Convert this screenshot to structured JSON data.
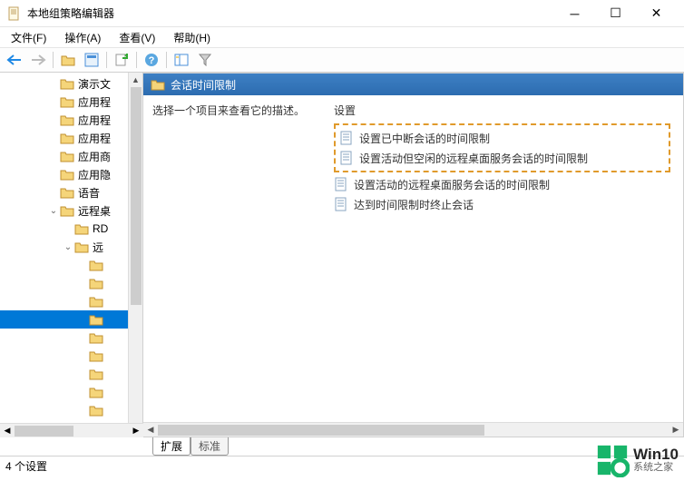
{
  "window": {
    "title": "本地组策略编辑器"
  },
  "menu": {
    "file": "文件(F)",
    "action": "操作(A)",
    "view": "查看(V)",
    "help": "帮助(H)"
  },
  "tree": {
    "items": [
      {
        "label": "演示文",
        "depth": 3,
        "expander": ""
      },
      {
        "label": "应用程",
        "depth": 3,
        "expander": ""
      },
      {
        "label": "应用程",
        "depth": 3,
        "expander": ""
      },
      {
        "label": "应用程",
        "depth": 3,
        "expander": ""
      },
      {
        "label": "应用商",
        "depth": 3,
        "expander": ""
      },
      {
        "label": "应用隐",
        "depth": 3,
        "expander": ""
      },
      {
        "label": "语音",
        "depth": 3,
        "expander": ""
      },
      {
        "label": "远程桌",
        "depth": 3,
        "expander": "v"
      },
      {
        "label": "RD",
        "depth": 4,
        "expander": ""
      },
      {
        "label": "远",
        "depth": 4,
        "expander": "v"
      },
      {
        "label": "",
        "depth": 5,
        "expander": ""
      },
      {
        "label": "",
        "depth": 5,
        "expander": ""
      },
      {
        "label": "",
        "depth": 5,
        "expander": ""
      },
      {
        "label": "",
        "depth": 5,
        "expander": "",
        "selected": true
      },
      {
        "label": "",
        "depth": 5,
        "expander": ""
      },
      {
        "label": "",
        "depth": 5,
        "expander": ""
      },
      {
        "label": "",
        "depth": 5,
        "expander": ""
      },
      {
        "label": "",
        "depth": 5,
        "expander": ""
      },
      {
        "label": "",
        "depth": 5,
        "expander": ""
      }
    ]
  },
  "content": {
    "header": "会话时间限制",
    "desc": "选择一个项目来查看它的描述。",
    "col_header": "设置",
    "items": [
      {
        "label": "设置已中断会话的时间限制",
        "highlighted": true
      },
      {
        "label": "设置活动但空闲的远程桌面服务会话的时间限制",
        "highlighted": true
      },
      {
        "label": "设置活动的远程桌面服务会话的时间限制",
        "highlighted": false
      },
      {
        "label": "达到时间限制时终止会话",
        "highlighted": false
      }
    ]
  },
  "tabs": {
    "extended": "扩展",
    "standard": "标准"
  },
  "status": "4 个设置",
  "watermark": {
    "top": "Win10",
    "bot": "系统之家"
  }
}
